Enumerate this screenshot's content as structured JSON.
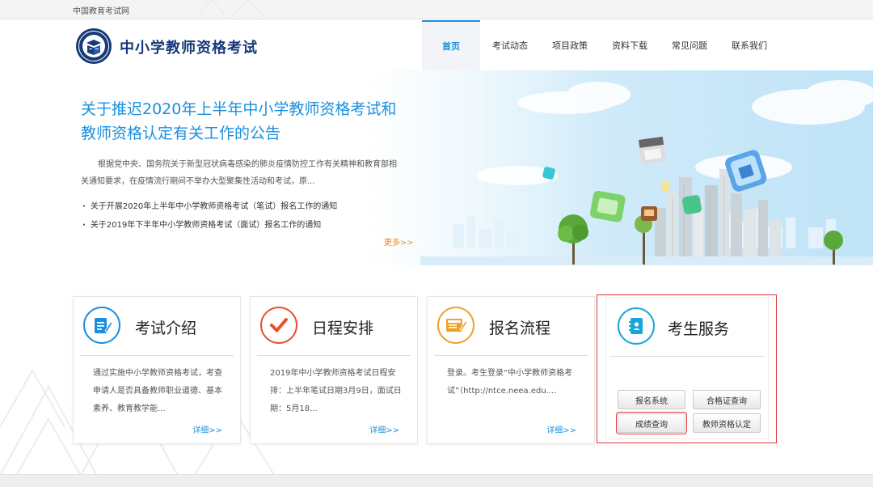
{
  "topbar": {
    "site_name": "中国教育考试网"
  },
  "header": {
    "brand": "中小学教师资格考试",
    "nav": [
      {
        "label": "首页",
        "active": true
      },
      {
        "label": "考试动态",
        "active": false
      },
      {
        "label": "项目政策",
        "active": false
      },
      {
        "label": "资料下载",
        "active": false
      },
      {
        "label": "常见问题",
        "active": false
      },
      {
        "label": "联系我们",
        "active": false
      }
    ]
  },
  "banner": {
    "headline": "关于推迟2020年上半年中小学教师资格考试和教师资格认定有关工作的公告",
    "summary": "根据党中央、国务院关于新型冠状病毒感染的肺炎疫情防控工作有关精神和教育部相关通知要求，在疫情流行期间不举办大型聚集性活动和考试，原...",
    "news": [
      "关于开展2020年上半年中小学教师资格考试（笔试）报名工作的通知",
      "关于2019年下半年中小学教师资格考试（面试）报名工作的通知"
    ],
    "more": "更多>>"
  },
  "cards": [
    {
      "title": "考试介绍",
      "desc": "通过实施中小学教师资格考试，考查申请人是否具备教师职业道德、基本素养、教育教学能...",
      "detail": "详细>>"
    },
    {
      "title": "日程安排",
      "desc": "2019年中小学教师资格考试日程安排：上半年笔试日期3月9日，面试日期：5月18...",
      "detail": "详细>>"
    },
    {
      "title": "报名流程",
      "desc": "登录。考生登录“中小学教师资格考试”（http://ntce.neea.edu....",
      "detail": "详细>>"
    }
  ],
  "service": {
    "title": "考生服务",
    "buttons": [
      {
        "label": "报名系统"
      },
      {
        "label": "合格证查询"
      },
      {
        "label": "成绩查询",
        "highlighted": true
      },
      {
        "label": "教师资格认定"
      }
    ]
  },
  "colors": {
    "accent": "#1a8fe0",
    "brand": "#173a7a",
    "highlight": "#e0393b",
    "more": "#f08c1a"
  }
}
